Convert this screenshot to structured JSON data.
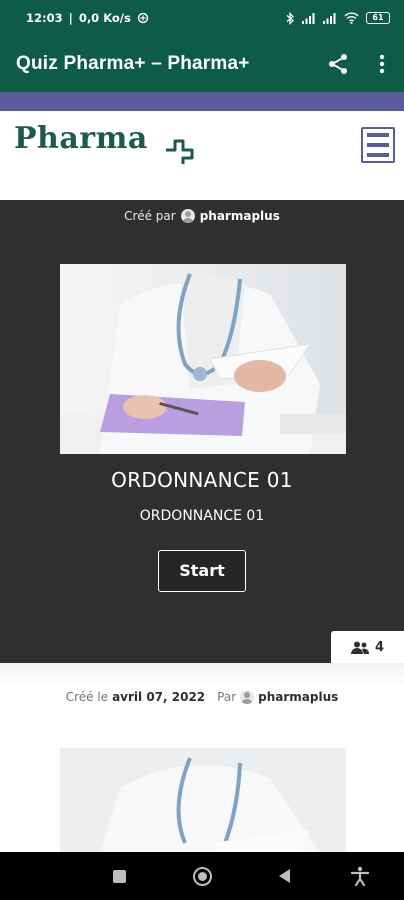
{
  "status_bar": {
    "time": "12:03",
    "network_speed": "0,0 Ko/s",
    "battery": "61",
    "icons": [
      "notification-icon",
      "bluetooth-icon",
      "signal-icon",
      "signal-icon",
      "wifi-icon",
      "battery-icon"
    ]
  },
  "app_bar": {
    "title": "Quiz Pharma+ – Pharma+",
    "actions": [
      "share-icon",
      "more-vert-icon"
    ]
  },
  "site_header": {
    "logo_text": "Pharma",
    "brand_color": "#1d5a48",
    "accent_color": "#5b5d98",
    "menu_icon": "hamburger-menu-icon"
  },
  "quiz_card": {
    "created_by_label": "Créé par",
    "author": "pharmaplus",
    "title": "ORDONNANCE 01",
    "subtitle": "ORDONNANCE 01",
    "start_label": "Start",
    "players_count": "4",
    "players_icon": "users-icon",
    "background_color": "#2f2f2f"
  },
  "second_card": {
    "created_on_label": "Créé le",
    "date": "avril 07, 2022",
    "by_label": "Par",
    "author": "pharmaplus"
  },
  "nav_bar": {
    "buttons": [
      "recents-icon",
      "home-icon",
      "back-icon",
      "accessibility-icon"
    ]
  }
}
